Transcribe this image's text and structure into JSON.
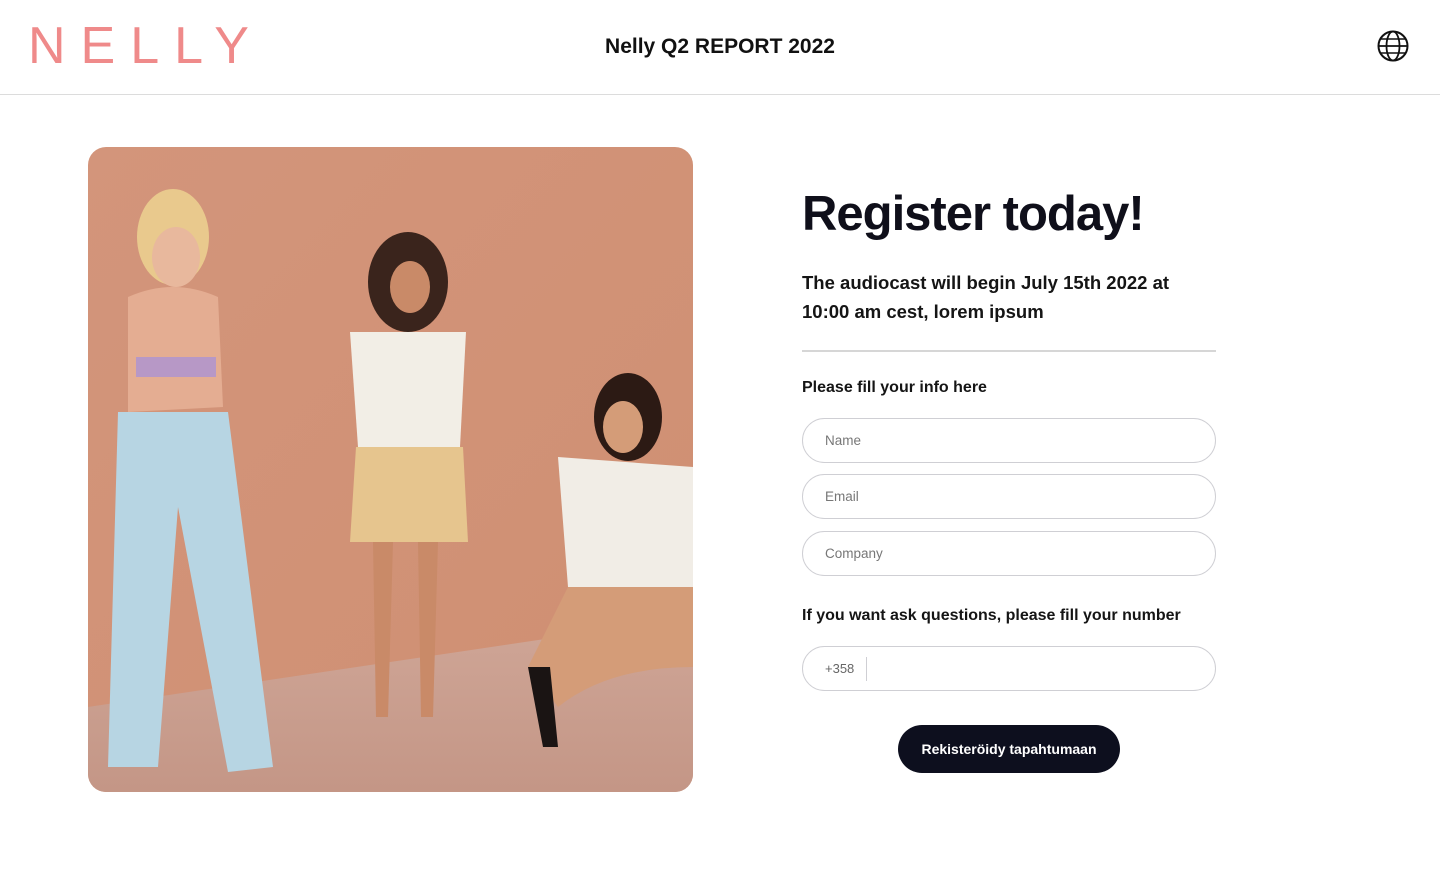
{
  "header": {
    "logo": "NELLY",
    "title": "Nelly Q2 REPORT 2022",
    "language_icon": "globe-icon"
  },
  "hero_image": {
    "icon": "photo"
  },
  "form": {
    "headline": "Register today!",
    "subtitle": "The audiocast will begin July 15th 2022 at 10:00 am cest, lorem ipsum",
    "info_label": "Please fill your info here",
    "name_placeholder": "Name",
    "email_placeholder": "Email",
    "company_placeholder": "Company",
    "phone_label": "If you want ask questions, please fill your number",
    "phone_prefix": "+358",
    "submit_label": "Rekisteröidy tapahtumaan"
  },
  "colors": {
    "brand": "#ef8a8a",
    "button": "#0d0f1e",
    "photo_background": "#d59a7f"
  }
}
